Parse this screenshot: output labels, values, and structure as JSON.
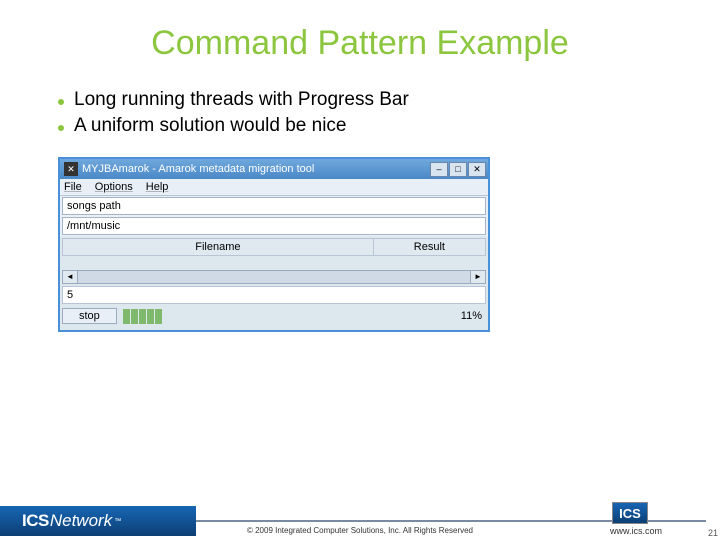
{
  "title": "Command Pattern Example",
  "bullets": [
    "Long running threads with Progress Bar",
    "A uniform solution would be nice"
  ],
  "window": {
    "title": "MYJBAmarok - Amarok metadata migration tool",
    "menu": {
      "file": "File",
      "options": "Options",
      "help": "Help"
    },
    "inputs": {
      "label": "songs path",
      "path": "/mnt/music"
    },
    "table": {
      "col1": "Filename",
      "col2": "Result"
    },
    "count": "5",
    "stop": "stop",
    "percent": "11%"
  },
  "footer": {
    "brand_ics": "ICS",
    "brand_net": "Network",
    "tm": "™",
    "copyright": "© 2009 Integrated Computer Solutions, Inc. All Rights Reserved",
    "badge": "ICS",
    "url": "www.ics.com",
    "page": "21"
  }
}
